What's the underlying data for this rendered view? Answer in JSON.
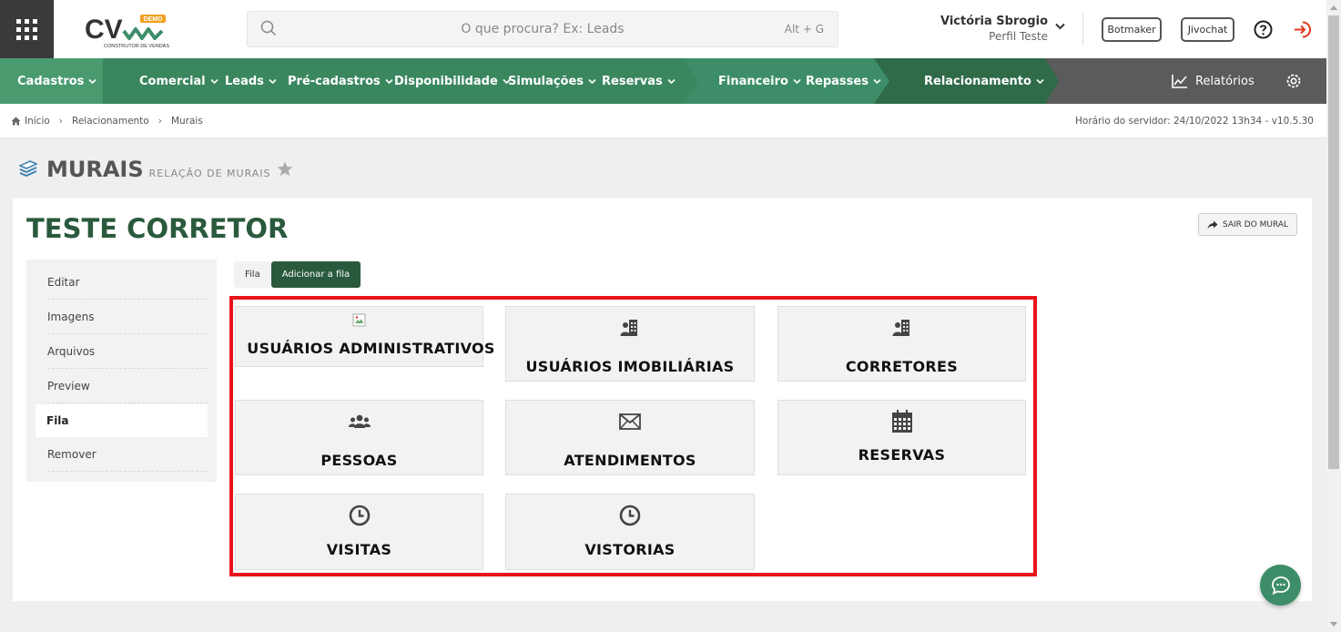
{
  "header": {
    "logo_text": "CV",
    "logo_badge": "DEMO",
    "logo_tagline": "CONSTRUTOR DE VENDAS",
    "search_placeholder": "O que procura? Ex: Leads",
    "search_shortcut": "Alt + G",
    "user_name": "Victória Sbrogio",
    "user_profile": "Perfil Teste",
    "botmaker": "Botmaker",
    "jivochat": "Jivochat"
  },
  "nav": {
    "items": [
      {
        "label": "Cadastros"
      },
      {
        "label": "Comercial"
      },
      {
        "label": "Leads"
      },
      {
        "label": "Pré-cadastros"
      },
      {
        "label": "Disponibilidade"
      },
      {
        "label": "Simulações"
      },
      {
        "label": "Reservas"
      },
      {
        "label": "Financeiro"
      },
      {
        "label": "Repasses"
      },
      {
        "label": "Relacionamento"
      }
    ],
    "reports": "Relatórios",
    "colors": {
      "primary": "#3d8e68",
      "dark": "#2a5a3d",
      "mid": "#4a9a70",
      "gray": "#5b5b5b"
    }
  },
  "breadcrumb": {
    "items": [
      "Início",
      "Relacionamento",
      "Murais"
    ],
    "server_time": "Horário do servidor: 24/10/2022 13h34 - v10.5.30"
  },
  "page": {
    "title": "MURAIS",
    "subtitle": "RELAÇÃO DE MURAIS"
  },
  "mural": {
    "title": "TESTE CORRETOR",
    "exit_button": "SAIR DO MURAL",
    "menu": [
      "Editar",
      "Imagens",
      "Arquivos",
      "Preview",
      "Fila",
      "Remover"
    ],
    "active_menu": "Fila",
    "tabs": [
      "Fila",
      "Adicionar a fila"
    ],
    "active_tab": "Adicionar a fila",
    "cards": [
      {
        "label": "USUÁRIOS ADMINISTRATIVOS",
        "icon": "broken-image-icon"
      },
      {
        "label": "USUÁRIOS IMOBILIÁRIAS",
        "icon": "building-user-icon"
      },
      {
        "label": "CORRETORES",
        "icon": "building-user-icon"
      },
      {
        "label": "PESSOAS",
        "icon": "users-icon"
      },
      {
        "label": "ATENDIMENTOS",
        "icon": "envelope-icon"
      },
      {
        "label": "RESERVAS",
        "icon": "calendar-icon"
      },
      {
        "label": "VISITAS",
        "icon": "clock-icon"
      },
      {
        "label": "VISTORIAS",
        "icon": "clock-icon"
      }
    ],
    "highlight_color": "#e8141b"
  }
}
